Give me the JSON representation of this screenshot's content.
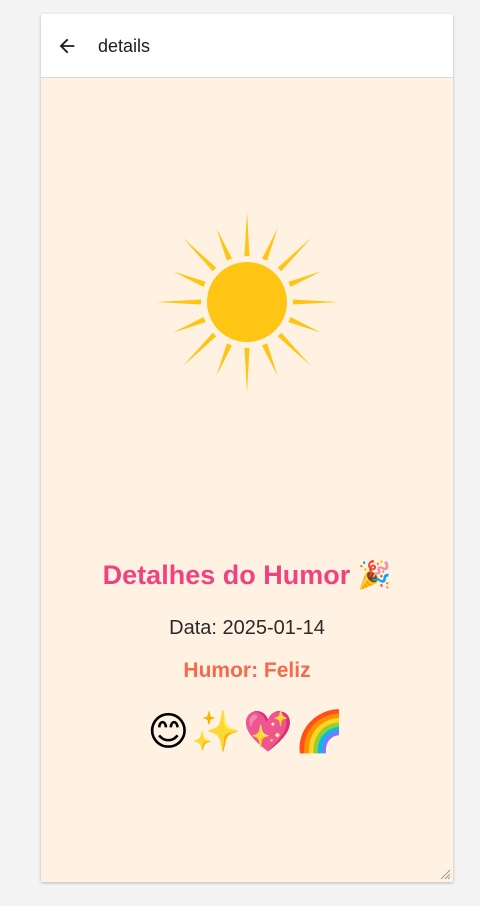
{
  "colors": {
    "background": "#fff2e3",
    "title": "#f0427e",
    "mood": "#f46a4e",
    "sun": "#ffc515"
  },
  "appbar": {
    "back_icon": "arrow-back-icon",
    "title": "details"
  },
  "hero": {
    "icon": "sun-icon"
  },
  "details": {
    "heading": "Detalhes do Humor 🎉",
    "date_line": "Data: 2025-01-14",
    "mood_line": "Humor: Feliz",
    "emojis": "😊✨💖🌈"
  }
}
